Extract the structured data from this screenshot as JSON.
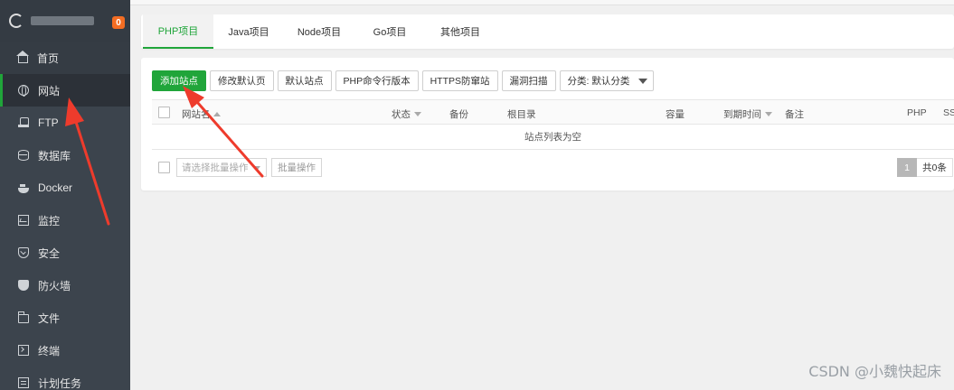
{
  "brand": {
    "badge": "0",
    "accent": "#20a53a",
    "badge_color": "#f36d23"
  },
  "sidebar": {
    "items": [
      {
        "label": "首页",
        "icon": "home-icon"
      },
      {
        "label": "网站",
        "icon": "globe-icon"
      },
      {
        "label": "FTP",
        "icon": "ftp-icon"
      },
      {
        "label": "数据库",
        "icon": "database-icon"
      },
      {
        "label": "Docker",
        "icon": "docker-icon"
      },
      {
        "label": "监控",
        "icon": "monitor-icon"
      },
      {
        "label": "安全",
        "icon": "shield-icon"
      },
      {
        "label": "防火墙",
        "icon": "firewall-icon"
      },
      {
        "label": "文件",
        "icon": "folder-icon"
      },
      {
        "label": "终端",
        "icon": "terminal-icon"
      },
      {
        "label": "计划任务",
        "icon": "task-icon"
      }
    ]
  },
  "tabs": [
    "PHP项目",
    "Java项目",
    "Node项目",
    "Go项目",
    "其他项目"
  ],
  "toolbar": {
    "add_site": "添加站点",
    "modify_default_page": "修改默认页",
    "default_site": "默认站点",
    "php_cli_version": "PHP命令行版本",
    "https_anti_steal": "HTTPS防窜站",
    "vuln_scan": "漏洞扫描",
    "category_select": "分类: 默认分类"
  },
  "table": {
    "headers": {
      "site_name": "网站名",
      "status": "状态",
      "backup": "备份",
      "root": "根目录",
      "capacity": "容量",
      "expire": "到期时间",
      "note": "备注",
      "php": "PHP",
      "ssl": "SS"
    },
    "empty_text": "站点列表为空"
  },
  "footer": {
    "batch_placeholder": "请选择批量操作",
    "batch_button": "批量操作",
    "page": "1",
    "total": "共0条"
  },
  "watermark": "CSDN @小魏快起床"
}
